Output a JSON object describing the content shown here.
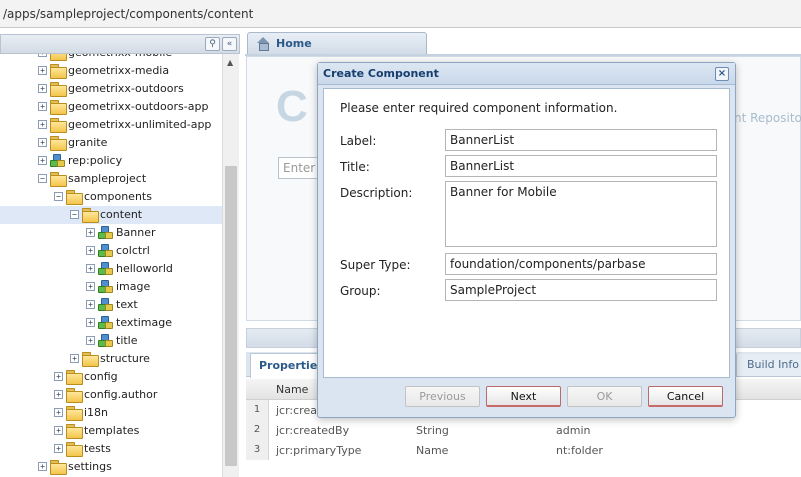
{
  "pathbar": {
    "path": "/apps/sampleproject/components/content"
  },
  "tree": {
    "items": [
      {
        "label": "geometrixx-mobile",
        "kind": "folder",
        "level": 0,
        "toggle": "+"
      },
      {
        "label": "geometrixx-media",
        "kind": "folder",
        "level": 0,
        "toggle": "+"
      },
      {
        "label": "geometrixx-outdoors",
        "kind": "folder",
        "level": 0,
        "toggle": "+"
      },
      {
        "label": "geometrixx-outdoors-app",
        "kind": "folder",
        "level": 0,
        "toggle": "+"
      },
      {
        "label": "geometrixx-unlimited-app",
        "kind": "folder",
        "level": 0,
        "toggle": "+"
      },
      {
        "label": "granite",
        "kind": "folder",
        "level": 0,
        "toggle": "+"
      },
      {
        "label": "rep:policy",
        "kind": "component",
        "level": 0,
        "toggle": "+"
      },
      {
        "label": "sampleproject",
        "kind": "folder",
        "level": 0,
        "toggle": "−"
      },
      {
        "label": "components",
        "kind": "folder",
        "level": 1,
        "toggle": "−"
      },
      {
        "label": "content",
        "kind": "folder",
        "level": 2,
        "toggle": "−",
        "selected": true
      },
      {
        "label": "Banner",
        "kind": "component",
        "level": 3,
        "toggle": "+"
      },
      {
        "label": "colctrl",
        "kind": "component",
        "level": 3,
        "toggle": "+"
      },
      {
        "label": "helloworld",
        "kind": "component",
        "level": 3,
        "toggle": "+"
      },
      {
        "label": "image",
        "kind": "component",
        "level": 3,
        "toggle": "+"
      },
      {
        "label": "text",
        "kind": "component",
        "level": 3,
        "toggle": "+"
      },
      {
        "label": "textimage",
        "kind": "component",
        "level": 3,
        "toggle": "+"
      },
      {
        "label": "title",
        "kind": "component",
        "level": 3,
        "toggle": "+"
      },
      {
        "label": "structure",
        "kind": "folder",
        "level": 2,
        "toggle": "+"
      },
      {
        "label": "config",
        "kind": "folder",
        "level": 1,
        "toggle": "+"
      },
      {
        "label": "config.author",
        "kind": "folder",
        "level": 1,
        "toggle": "+"
      },
      {
        "label": "i18n",
        "kind": "folder",
        "level": 1,
        "toggle": "+"
      },
      {
        "label": "templates",
        "kind": "folder",
        "level": 1,
        "toggle": "+"
      },
      {
        "label": "tests",
        "kind": "folder",
        "level": 1,
        "toggle": "+"
      },
      {
        "label": "settings",
        "kind": "folder",
        "level": 0,
        "toggle": "+"
      }
    ]
  },
  "toolbar": {
    "binoculars": "⚲",
    "collapse": "«"
  },
  "tabs": {
    "home": "Home"
  },
  "home": {
    "big_letter": "C",
    "repo_text": "nt Repositor",
    "search_placeholder": "Enter s"
  },
  "properties": {
    "tab_label": "Properties",
    "build_info": "Build Info",
    "column_name": "Name",
    "rows": [
      {
        "num": "1",
        "name": "jcr:created",
        "type": "",
        "value": ""
      },
      {
        "num": "2",
        "name": "jcr:createdBy",
        "type": "String",
        "value": "admin"
      },
      {
        "num": "3",
        "name": "jcr:primaryType",
        "type": "Name",
        "value": "nt:folder"
      }
    ]
  },
  "dialog": {
    "title": "Create Component",
    "close": "×",
    "instruction": "Please enter required component information.",
    "label_label": "Label:",
    "label_value": "BannerList",
    "title_label": "Title:",
    "title_value": "BannerList",
    "description_label": "Description:",
    "description_value": "Banner for Mobile",
    "supertype_label": "Super Type:",
    "supertype_value": "foundation/components/parbase",
    "group_label": "Group:",
    "group_value": "SampleProject",
    "buttons": {
      "previous": "Previous",
      "next": "Next",
      "ok": "OK",
      "cancel": "Cancel"
    }
  }
}
